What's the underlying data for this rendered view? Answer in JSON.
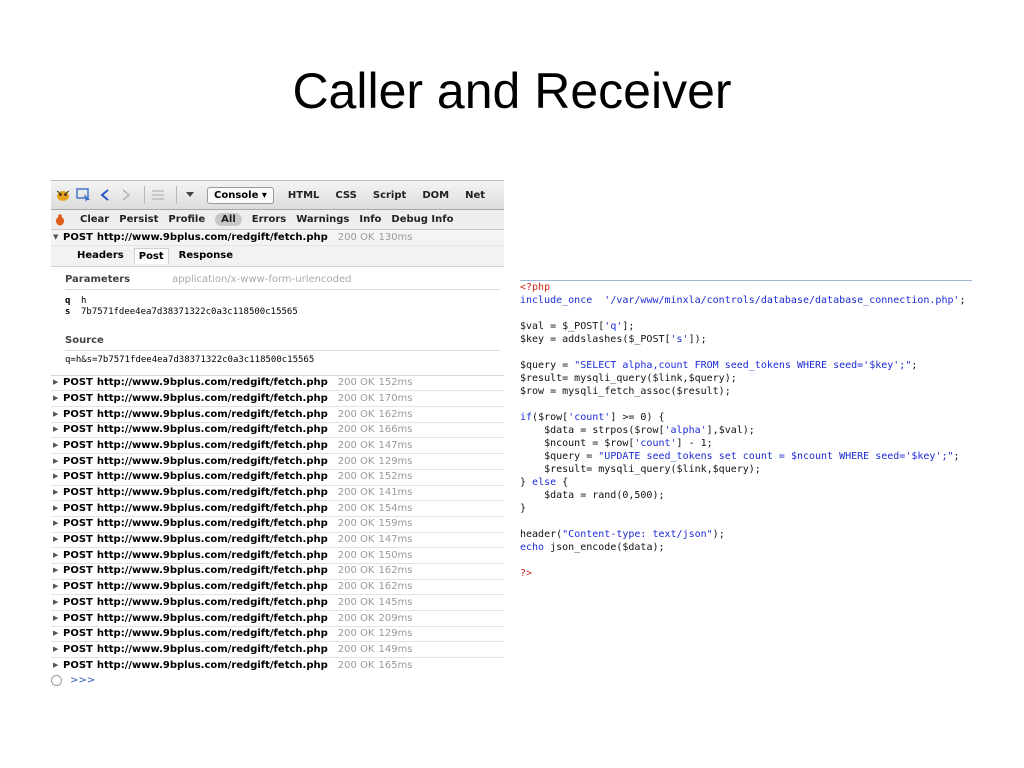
{
  "slide": {
    "title": "Caller and Receiver"
  },
  "firebug": {
    "toolbar": {
      "console_label": "Console ▾",
      "tabs": [
        "HTML",
        "CSS",
        "Script",
        "DOM",
        "Net"
      ],
      "icons": [
        "firebug-icon",
        "inspect-icon",
        "back-icon",
        "forward-icon",
        "list-icon",
        "menu-icon"
      ]
    },
    "filters": {
      "buttons": [
        "Clear",
        "Persist",
        "Profile"
      ],
      "categories": [
        "All",
        "Errors",
        "Warnings",
        "Info",
        "Debug Info"
      ],
      "active": "All"
    },
    "open_request": {
      "method": "POST",
      "url": "http://www.9bplus.com/redgift/fetch.php",
      "status": "200 OK",
      "time": "130ms"
    },
    "detail": {
      "tabs": [
        "Headers",
        "Post",
        "Response"
      ],
      "selected_tab": "Post",
      "parameters_label": "Parameters",
      "encoding": "application/x-www-form-urlencoded",
      "params": [
        {
          "key": "q",
          "value": "h"
        },
        {
          "key": "s",
          "value": "7b7571fdee4ea7d38371322c0a3c118500c15565"
        }
      ],
      "source_label": "Source",
      "source": "q=h&s=7b7571fdee4ea7d38371322c0a3c118500c15565"
    },
    "requests": [
      {
        "method": "POST",
        "url": "http://www.9bplus.com/redgift/fetch.php",
        "status": "200 OK",
        "time": "152ms"
      },
      {
        "method": "POST",
        "url": "http://www.9bplus.com/redgift/fetch.php",
        "status": "200 OK",
        "time": "170ms"
      },
      {
        "method": "POST",
        "url": "http://www.9bplus.com/redgift/fetch.php",
        "status": "200 OK",
        "time": "162ms"
      },
      {
        "method": "POST",
        "url": "http://www.9bplus.com/redgift/fetch.php",
        "status": "200 OK",
        "time": "166ms"
      },
      {
        "method": "POST",
        "url": "http://www.9bplus.com/redgift/fetch.php",
        "status": "200 OK",
        "time": "147ms"
      },
      {
        "method": "POST",
        "url": "http://www.9bplus.com/redgift/fetch.php",
        "status": "200 OK",
        "time": "129ms"
      },
      {
        "method": "POST",
        "url": "http://www.9bplus.com/redgift/fetch.php",
        "status": "200 OK",
        "time": "152ms"
      },
      {
        "method": "POST",
        "url": "http://www.9bplus.com/redgift/fetch.php",
        "status": "200 OK",
        "time": "141ms"
      },
      {
        "method": "POST",
        "url": "http://www.9bplus.com/redgift/fetch.php",
        "status": "200 OK",
        "time": "154ms"
      },
      {
        "method": "POST",
        "url": "http://www.9bplus.com/redgift/fetch.php",
        "status": "200 OK",
        "time": "159ms"
      },
      {
        "method": "POST",
        "url": "http://www.9bplus.com/redgift/fetch.php",
        "status": "200 OK",
        "time": "147ms"
      },
      {
        "method": "POST",
        "url": "http://www.9bplus.com/redgift/fetch.php",
        "status": "200 OK",
        "time": "150ms"
      },
      {
        "method": "POST",
        "url": "http://www.9bplus.com/redgift/fetch.php",
        "status": "200 OK",
        "time": "162ms"
      },
      {
        "method": "POST",
        "url": "http://www.9bplus.com/redgift/fetch.php",
        "status": "200 OK",
        "time": "162ms"
      },
      {
        "method": "POST",
        "url": "http://www.9bplus.com/redgift/fetch.php",
        "status": "200 OK",
        "time": "145ms"
      },
      {
        "method": "POST",
        "url": "http://www.9bplus.com/redgift/fetch.php",
        "status": "200 OK",
        "time": "209ms"
      },
      {
        "method": "POST",
        "url": "http://www.9bplus.com/redgift/fetch.php",
        "status": "200 OK",
        "time": "129ms"
      },
      {
        "method": "POST",
        "url": "http://www.9bplus.com/redgift/fetch.php",
        "status": "200 OK",
        "time": "149ms"
      },
      {
        "method": "POST",
        "url": "http://www.9bplus.com/redgift/fetch.php",
        "status": "200 OK",
        "time": "165ms"
      }
    ],
    "command_prompt": ">>>"
  },
  "code": {
    "lines": [
      [
        [
          "ph",
          "<?php"
        ]
      ],
      [
        [
          "kw",
          "include_once"
        ],
        [
          "",
          "  "
        ],
        [
          "st",
          "'/var/www/minxla/controls/database/database_connection.php'"
        ],
        [
          "",
          ";"
        ]
      ],
      [],
      [
        [
          "",
          "$val = $_POST["
        ],
        [
          "st",
          "'q'"
        ],
        [
          "",
          "];"
        ]
      ],
      [
        [
          "",
          "$key = addslashes($_POST["
        ],
        [
          "st",
          "'s'"
        ],
        [
          "",
          "]);"
        ]
      ],
      [],
      [
        [
          "",
          "$query = "
        ],
        [
          "st",
          "\"SELECT alpha,count FROM seed_tokens WHERE seed='$key';\""
        ],
        [
          "",
          ";"
        ]
      ],
      [
        [
          "",
          "$result= mysqli_query($link,$query);"
        ]
      ],
      [
        [
          "",
          "$row = mysqli_fetch_assoc($result);"
        ]
      ],
      [],
      [
        [
          "kw",
          "if"
        ],
        [
          "",
          "($row["
        ],
        [
          "st",
          "'count'"
        ],
        [
          "",
          "] >= 0) {"
        ]
      ],
      [
        [
          "",
          "    $data = strpos($row["
        ],
        [
          "st",
          "'alpha'"
        ],
        [
          "",
          "],$val);"
        ]
      ],
      [
        [
          "",
          "    $ncount = $row["
        ],
        [
          "st",
          "'count'"
        ],
        [
          "",
          "] - 1;"
        ]
      ],
      [
        [
          "",
          "    $query = "
        ],
        [
          "st",
          "\"UPDATE seed_tokens set count = $ncount WHERE seed='$key';\""
        ],
        [
          "",
          ";"
        ]
      ],
      [
        [
          "",
          "    $result= mysqli_query($link,$query);"
        ]
      ],
      [
        [
          "",
          "} "
        ],
        [
          "kw",
          "else"
        ],
        [
          "",
          " {"
        ]
      ],
      [
        [
          "",
          "    $data = rand(0,500);"
        ]
      ],
      [
        [
          "",
          "}"
        ]
      ],
      [],
      [
        [
          "",
          "header("
        ],
        [
          "st",
          "\"Content-type: text/json\""
        ],
        [
          "",
          ");"
        ]
      ],
      [
        [
          "kw",
          "echo"
        ],
        [
          "",
          " json_encode($data);"
        ]
      ],
      [],
      [
        [
          "ph",
          "?>"
        ]
      ]
    ]
  }
}
